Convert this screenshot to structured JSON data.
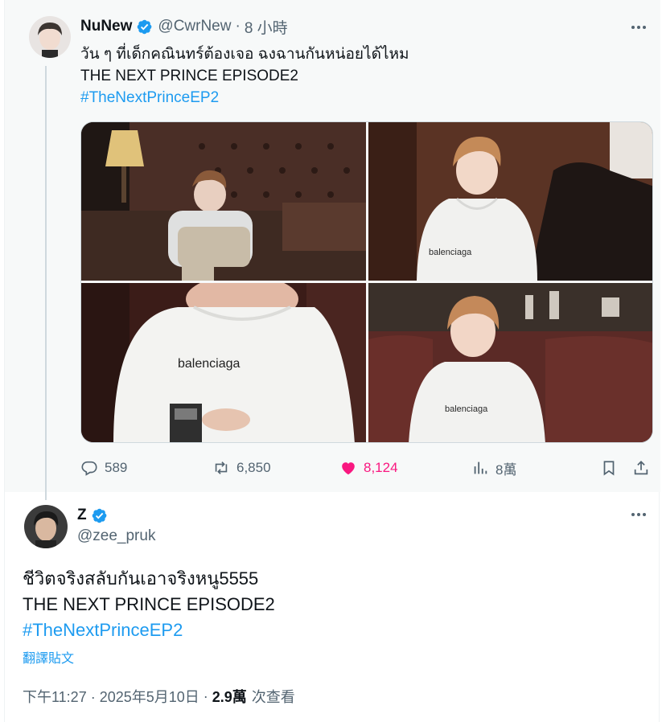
{
  "parent_tweet": {
    "author_name": "NuNew",
    "author_handle": "@CwrNew",
    "separator": "·",
    "time": "8 小時",
    "lines": [
      "วัน ๆ ที่เด็กคณินทร์ต้องเจอ ฉงฉานกันหน่อยได้ไหม",
      "THE NEXT PRINCE EPISODE2"
    ],
    "hashtag": "#TheNextPrinceEP2",
    "image_captions": [
      "balenciaga",
      "balenciaga",
      "balenciaga"
    ],
    "stats": {
      "replies": "589",
      "retweets": "6,850",
      "likes": "8,124",
      "views": "8萬"
    },
    "icons": {
      "reply": "reply-icon",
      "retweet": "retweet-icon",
      "like": "heart-filled-icon",
      "views": "views-icon",
      "bookmark": "bookmark-icon",
      "share": "share-icon",
      "more": "more-icon",
      "verified": "verified-badge-icon"
    }
  },
  "main_tweet": {
    "author_name": "Z",
    "author_handle": "@zee_pruk",
    "lines": [
      "ชีวิตจริงสลับกันเอาจริงหนู5555",
      "THE NEXT PRINCE EPISODE2"
    ],
    "hashtag": "#TheNextPrinceEP2",
    "translate": "翻譯貼文",
    "timestamp": "下午11:27 · 2025年5月10日",
    "separator": "·",
    "views_count": "2.9萬",
    "views_label": "次查看"
  },
  "colors": {
    "accent": "#1d9bf0",
    "like": "#f91880",
    "muted": "#536471",
    "text": "#0f1419",
    "parent_bg": "#f7f9f9"
  }
}
